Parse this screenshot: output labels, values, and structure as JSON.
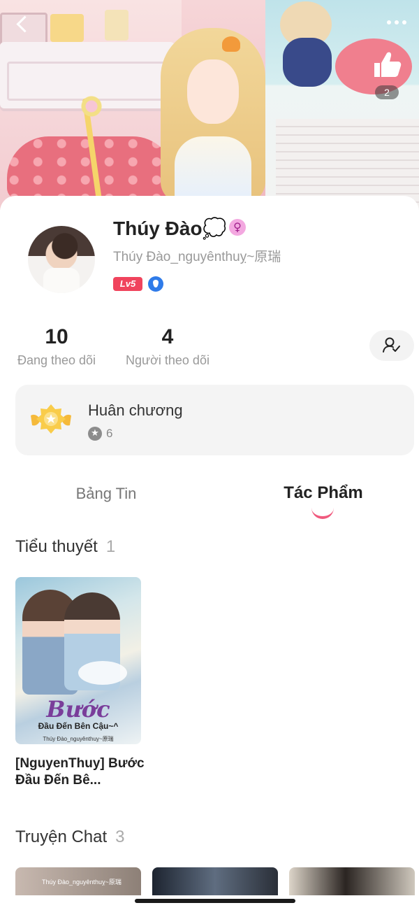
{
  "banner": {
    "like_count": "2"
  },
  "profile": {
    "name": "Thúy Đào💭",
    "username": "Thúy Đào_nguyênthuỵ~原瑞",
    "level": "Lv5"
  },
  "stats": {
    "following_count": "10",
    "following_label": "Đang theo dõi",
    "followers_count": "4",
    "followers_label": "Người theo dõi"
  },
  "medals": {
    "title": "Huân chương",
    "count": "6"
  },
  "tabs": [
    {
      "label": "Bảng Tin",
      "active": false
    },
    {
      "label": "Tác Phẩm",
      "active": true
    }
  ],
  "novels": {
    "title": "Tiểu thuyết",
    "count": "1",
    "items": [
      {
        "cover_title": "Bước",
        "cover_subtitle": "Đầu Đến Bên Cậu~^",
        "cover_author": "Thúy Đào_nguyênthuỵ~原瑞",
        "name": "[NguyenThuy] Bước Đầu Đến Bê..."
      }
    ]
  },
  "chats": {
    "title": "Truyện Chat",
    "count": "3",
    "first_thumb_text": "Thúy Đào_nguyênthuỵ~原瑞"
  },
  "icons": {
    "back": "chevron-left-icon",
    "more": "more-dots-icon",
    "like": "thumbs-up-icon",
    "gender": "female-icon",
    "verified": "shield-icon",
    "follow": "user-check-icon",
    "medal": "medal-icon",
    "medal_star": "star-icon"
  },
  "colors": {
    "accent": "#f05a7e",
    "level_badge": "#f0445d",
    "verified_blue": "#2f7be9",
    "gender_pink": "#f3a8e0"
  }
}
